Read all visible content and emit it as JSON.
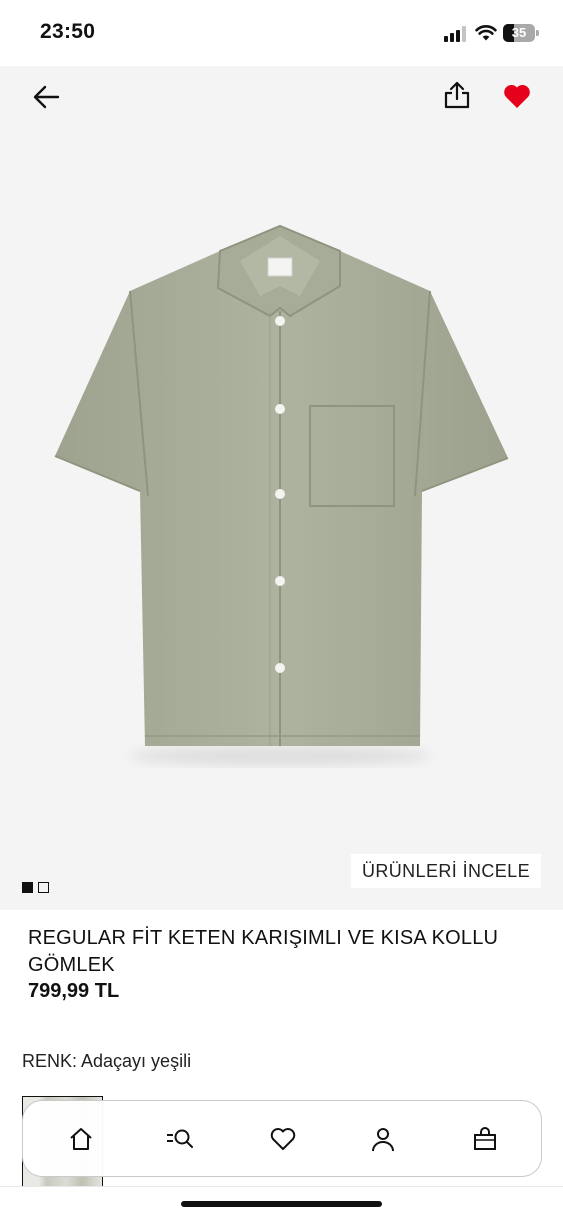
{
  "status_bar": {
    "time": "23:50",
    "battery_level": "35",
    "battery_fraction": 0.35
  },
  "header": {
    "back_icon": "arrow-left-icon",
    "share_icon": "share-icon",
    "favorite_icon": "heart-filled-icon",
    "favorite_active": true,
    "favorite_color": "#e5001b"
  },
  "gallery": {
    "image_count": 2,
    "active_index": 0,
    "inspect_label": "ÜRÜNLERİ İNCELE",
    "background": "#f4f4f4",
    "shirt_color": "#a9af9b"
  },
  "product": {
    "title": "REGULAR FİT KETEN KARIŞIMLI VE KISA KOLLU GÖMLEK",
    "price": "799,99 TL",
    "color_label": "RENK: Adaçayı yeşili"
  },
  "tabbar": {
    "items": [
      {
        "icon": "home-icon"
      },
      {
        "icon": "search-icon"
      },
      {
        "icon": "heart-outline-icon"
      },
      {
        "icon": "user-icon"
      },
      {
        "icon": "shopping-bag-icon"
      }
    ]
  }
}
